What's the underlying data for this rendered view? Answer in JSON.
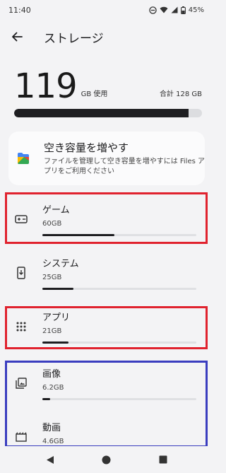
{
  "status_bar": {
    "time": "11:40",
    "battery": "45%"
  },
  "app_bar": {
    "title": "ストレージ"
  },
  "usage": {
    "used": "119",
    "used_unit": "GB 使用",
    "total": "合計 128 GB",
    "used_fraction": 0.93
  },
  "free_up": {
    "title": "空き容量を増やす",
    "description": "ファイルを管理して空き容量を増やすには Files アプリをご利用ください"
  },
  "categories": [
    {
      "label": "ゲーム",
      "size": "60GB",
      "fraction": 0.47,
      "icon": "gamepad-icon"
    },
    {
      "label": "システム",
      "size": "25GB",
      "fraction": 0.2,
      "icon": "system-update-icon"
    },
    {
      "label": "アプリ",
      "size": "21GB",
      "fraction": 0.17,
      "icon": "apps-grid-icon"
    },
    {
      "label": "画像",
      "size": "6.2GB",
      "fraction": 0.05,
      "icon": "photo-library-icon"
    },
    {
      "label": "動画",
      "size": "4.6GB",
      "fraction": 0.04,
      "icon": "movie-icon"
    }
  ],
  "colors": {
    "highlight_red": "#e0222e",
    "highlight_blue": "#3a3dbf",
    "bar_fill": "#1e1e21"
  }
}
